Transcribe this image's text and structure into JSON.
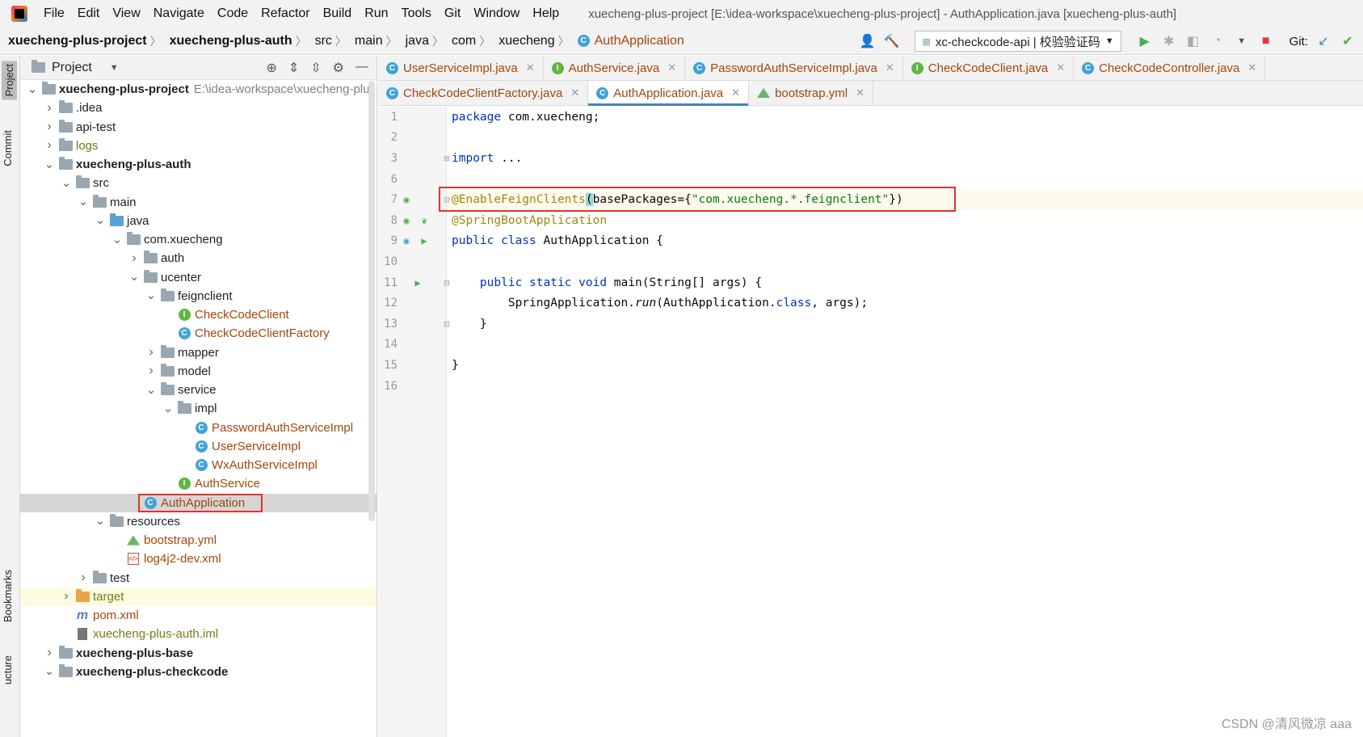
{
  "menu": [
    "File",
    "Edit",
    "View",
    "Navigate",
    "Code",
    "Refactor",
    "Build",
    "Run",
    "Tools",
    "Git",
    "Window",
    "Help"
  ],
  "window_title": "xuecheng-plus-project [E:\\idea-workspace\\xuecheng-plus-project] - AuthApplication.java [xuecheng-plus-auth]",
  "breadcrumbs": [
    "xuecheng-plus-project",
    "xuecheng-plus-auth",
    "src",
    "main",
    "java",
    "com",
    "xuecheng"
  ],
  "breadcrumb_current": "AuthApplication",
  "run_config": "xc-checkcode-api | 校验验证码",
  "git_label": "Git:",
  "stripe": {
    "project": "Project",
    "commit": "Commit",
    "bookmarks": "Bookmarks",
    "structure": "ucture"
  },
  "project_panel": {
    "title": "Project",
    "root_path": "E:\\idea-workspace\\xuecheng-plu",
    "tree": [
      {
        "label": "xuecheng-plus-project",
        "depth": 0,
        "arrow": "down",
        "icon": "module",
        "style": "bold"
      },
      {
        "label": ".idea",
        "depth": 1,
        "arrow": "right",
        "icon": "folder",
        "style": "normal"
      },
      {
        "label": "api-test",
        "depth": 1,
        "arrow": "right",
        "icon": "folder",
        "style": "normal"
      },
      {
        "label": "logs",
        "depth": 1,
        "arrow": "right",
        "icon": "folder",
        "style": "olive"
      },
      {
        "label": "xuecheng-plus-auth",
        "depth": 1,
        "arrow": "down",
        "icon": "module",
        "style": "bold"
      },
      {
        "label": "src",
        "depth": 2,
        "arrow": "down",
        "icon": "folder",
        "style": "normal"
      },
      {
        "label": "main",
        "depth": 3,
        "arrow": "down",
        "icon": "folder",
        "style": "normal"
      },
      {
        "label": "java",
        "depth": 4,
        "arrow": "down",
        "icon": "folder-blue",
        "style": "normal"
      },
      {
        "label": "com.xuecheng",
        "depth": 5,
        "arrow": "down",
        "icon": "package",
        "style": "normal"
      },
      {
        "label": "auth",
        "depth": 6,
        "arrow": "right",
        "icon": "package",
        "style": "normal"
      },
      {
        "label": "ucenter",
        "depth": 6,
        "arrow": "down",
        "icon": "package",
        "style": "normal"
      },
      {
        "label": "feignclient",
        "depth": 7,
        "arrow": "down",
        "icon": "package",
        "style": "normal"
      },
      {
        "label": "CheckCodeClient",
        "depth": 8,
        "arrow": "none",
        "icon": "interface",
        "style": "red"
      },
      {
        "label": "CheckCodeClientFactory",
        "depth": 8,
        "arrow": "none",
        "icon": "class",
        "style": "red"
      },
      {
        "label": "mapper",
        "depth": 7,
        "arrow": "right",
        "icon": "package",
        "style": "normal"
      },
      {
        "label": "model",
        "depth": 7,
        "arrow": "right",
        "icon": "package",
        "style": "normal"
      },
      {
        "label": "service",
        "depth": 7,
        "arrow": "down",
        "icon": "package",
        "style": "normal"
      },
      {
        "label": "impl",
        "depth": 8,
        "arrow": "down",
        "icon": "package",
        "style": "normal"
      },
      {
        "label": "PasswordAuthServiceImpl",
        "depth": 9,
        "arrow": "none",
        "icon": "class",
        "style": "red"
      },
      {
        "label": "UserServiceImpl",
        "depth": 9,
        "arrow": "none",
        "icon": "class",
        "style": "red"
      },
      {
        "label": "WxAuthServiceImpl",
        "depth": 9,
        "arrow": "none",
        "icon": "class",
        "style": "red"
      },
      {
        "label": "AuthService",
        "depth": 8,
        "arrow": "none",
        "icon": "interface",
        "style": "red"
      },
      {
        "label": "AuthApplication",
        "depth": 6,
        "arrow": "none",
        "icon": "class",
        "style": "red",
        "selected": true
      },
      {
        "label": "resources",
        "depth": 4,
        "arrow": "down",
        "icon": "folder",
        "style": "normal"
      },
      {
        "label": "bootstrap.yml",
        "depth": 5,
        "arrow": "none",
        "icon": "yml",
        "style": "red"
      },
      {
        "label": "log4j2-dev.xml",
        "depth": 5,
        "arrow": "none",
        "icon": "xml",
        "style": "red"
      },
      {
        "label": "test",
        "depth": 3,
        "arrow": "right",
        "icon": "folder",
        "style": "normal"
      },
      {
        "label": "target",
        "depth": 2,
        "arrow": "right",
        "icon": "folder-orange",
        "style": "olive",
        "yellow": true
      },
      {
        "label": "pom.xml",
        "depth": 2,
        "arrow": "none",
        "icon": "maven",
        "style": "red"
      },
      {
        "label": "xuecheng-plus-auth.iml",
        "depth": 2,
        "arrow": "none",
        "icon": "iml",
        "style": "olive"
      },
      {
        "label": "xuecheng-plus-base",
        "depth": 1,
        "arrow": "right",
        "icon": "module",
        "style": "bold"
      },
      {
        "label": "xuecheng-plus-checkcode",
        "depth": 1,
        "arrow": "down",
        "icon": "module",
        "style": "bold"
      }
    ]
  },
  "editor_tabs_row1": [
    {
      "label": "UserServiceImpl.java",
      "icon": "class"
    },
    {
      "label": "AuthService.java",
      "icon": "interface"
    },
    {
      "label": "PasswordAuthServiceImpl.java",
      "icon": "class"
    },
    {
      "label": "CheckCodeClient.java",
      "icon": "interface"
    },
    {
      "label": "CheckCodeController.java",
      "icon": "class"
    }
  ],
  "editor_tabs_row2": [
    {
      "label": "CheckCodeClientFactory.java",
      "icon": "class"
    },
    {
      "label": "AuthApplication.java",
      "icon": "class",
      "active": true
    },
    {
      "label": "bootstrap.yml",
      "icon": "yml"
    }
  ],
  "code_lines": [
    {
      "num": "1",
      "parts": [
        {
          "t": "package",
          "c": "kw"
        },
        {
          "t": " com.xuecheng;",
          "c": "plain"
        }
      ]
    },
    {
      "num": "2",
      "parts": []
    },
    {
      "num": "3",
      "parts": [
        {
          "t": "import",
          "c": "kw"
        },
        {
          "t": " ",
          "c": "plain"
        },
        {
          "t": "...",
          "c": "plain"
        }
      ]
    },
    {
      "num": "6",
      "parts": []
    },
    {
      "num": "7",
      "current": true,
      "parts": [
        {
          "t": "@EnableFeignClients",
          "c": "ann"
        },
        {
          "t": "(",
          "c": "plain"
        },
        {
          "t": "basePackages={",
          "c": "plain"
        },
        {
          "t": "\"com.xuecheng.*.feignclient\"",
          "c": "str"
        },
        {
          "t": "})",
          "c": "plain"
        }
      ]
    },
    {
      "num": "8",
      "parts": [
        {
          "t": "@SpringBootApplication",
          "c": "ann"
        }
      ]
    },
    {
      "num": "9",
      "parts": [
        {
          "t": "public class",
          "c": "kw"
        },
        {
          "t": " AuthApplication {",
          "c": "plain"
        }
      ]
    },
    {
      "num": "10",
      "parts": []
    },
    {
      "num": "11",
      "parts": [
        {
          "t": "    ",
          "c": "plain"
        },
        {
          "t": "public static void",
          "c": "kw"
        },
        {
          "t": " main(String[] args) {",
          "c": "plain"
        }
      ]
    },
    {
      "num": "12",
      "parts": [
        {
          "t": "        SpringApplication.",
          "c": "plain"
        },
        {
          "t": "run",
          "c": "plain it"
        },
        {
          "t": "(AuthApplication.",
          "c": "plain"
        },
        {
          "t": "class",
          "c": "kw"
        },
        {
          "t": ", args);",
          "c": "plain"
        }
      ]
    },
    {
      "num": "13",
      "parts": [
        {
          "t": "    }",
          "c": "plain"
        }
      ]
    },
    {
      "num": "14",
      "parts": []
    },
    {
      "num": "15",
      "parts": [
        {
          "t": "}",
          "c": "plain"
        }
      ]
    },
    {
      "num": "16",
      "parts": []
    }
  ],
  "watermark": "CSDN @清风微凉 aaa"
}
